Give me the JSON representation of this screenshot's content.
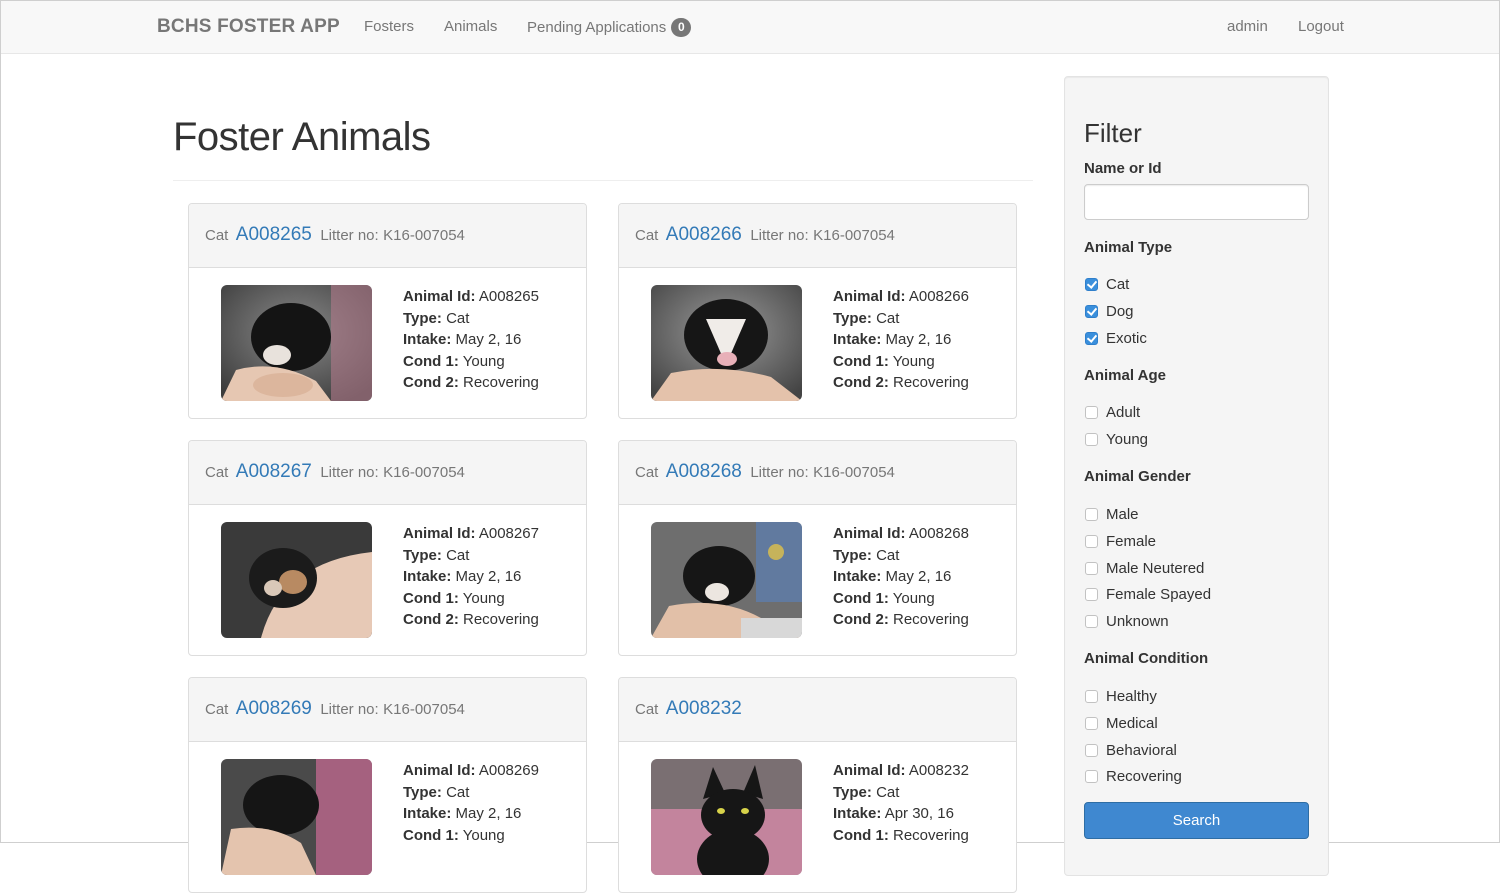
{
  "navbar": {
    "brand": "BCHS FOSTER APP",
    "links": {
      "fosters": "Fosters",
      "animals": "Animals",
      "pending": "Pending Applications",
      "pending_count": "0",
      "admin": "admin",
      "logout": "Logout"
    }
  },
  "page": {
    "title": "Foster Animals"
  },
  "labels": {
    "animal_id": "Animal Id:",
    "type": "Type:",
    "intake": "Intake:",
    "cond1": "Cond 1:",
    "cond2": "Cond 2:",
    "litter": "Litter no:"
  },
  "cards": [
    {
      "type": "Cat",
      "id": "A008265",
      "litter": "K16-007054",
      "animal_id": "A008265",
      "type_value": "Cat",
      "intake": "May 2, 16",
      "cond1": "Young",
      "cond2": "Recovering"
    },
    {
      "type": "Cat",
      "id": "A008266",
      "litter": "K16-007054",
      "animal_id": "A008266",
      "type_value": "Cat",
      "intake": "May 2, 16",
      "cond1": "Young",
      "cond2": "Recovering"
    },
    {
      "type": "Cat",
      "id": "A008267",
      "litter": "K16-007054",
      "animal_id": "A008267",
      "type_value": "Cat",
      "intake": "May 2, 16",
      "cond1": "Young",
      "cond2": "Recovering"
    },
    {
      "type": "Cat",
      "id": "A008268",
      "litter": "K16-007054",
      "animal_id": "A008268",
      "type_value": "Cat",
      "intake": "May 2, 16",
      "cond1": "Young",
      "cond2": "Recovering"
    },
    {
      "type": "Cat",
      "id": "A008269",
      "litter": "K16-007054",
      "animal_id": "A008269",
      "type_value": "Cat",
      "intake": "May 2, 16",
      "cond1": "Young"
    },
    {
      "type": "Cat",
      "id": "A008232",
      "animal_id": "A008232",
      "type_value": "Cat",
      "intake": "Apr 30, 16",
      "cond1": "Recovering"
    }
  ],
  "filter": {
    "title": "Filter",
    "name_label": "Name or Id",
    "name_value": "",
    "animal_type_label": "Animal Type",
    "animal_type": [
      {
        "label": "Cat",
        "checked": true
      },
      {
        "label": "Dog",
        "checked": true
      },
      {
        "label": "Exotic",
        "checked": true
      }
    ],
    "animal_age_label": "Animal Age",
    "animal_age": [
      {
        "label": "Adult",
        "checked": false
      },
      {
        "label": "Young",
        "checked": false
      }
    ],
    "animal_gender_label": "Animal Gender",
    "animal_gender": [
      {
        "label": "Male",
        "checked": false
      },
      {
        "label": "Female",
        "checked": false
      },
      {
        "label": "Male Neutered",
        "checked": false
      },
      {
        "label": "Female Spayed",
        "checked": false
      },
      {
        "label": "Unknown",
        "checked": false
      }
    ],
    "animal_condition_label": "Animal Condition",
    "animal_condition": [
      {
        "label": "Healthy",
        "checked": false
      },
      {
        "label": "Medical",
        "checked": false
      },
      {
        "label": "Behavioral",
        "checked": false
      },
      {
        "label": "Recovering",
        "checked": false
      }
    ],
    "search_label": "Search"
  },
  "colors": {
    "link": "#337ab7",
    "checked": "#3a8fdc",
    "button": "#3f88d0"
  }
}
